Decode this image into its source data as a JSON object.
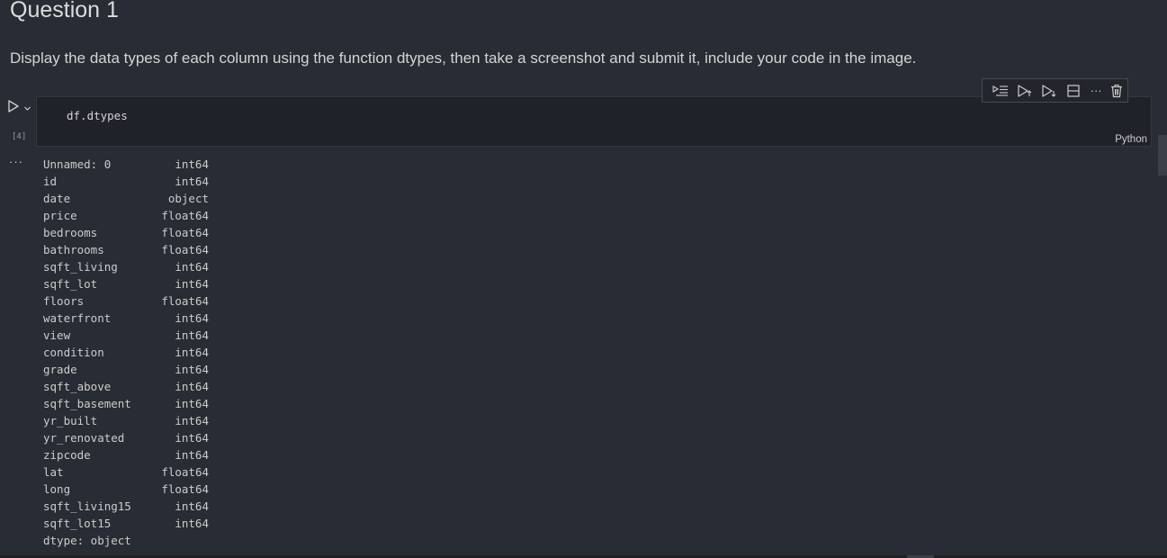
{
  "markdown": {
    "heading": "Question 1",
    "description": "Display the data types of each column using the function dtypes, then take a screenshot and submit it, include your code in the image."
  },
  "cell": {
    "execution_count": "[4]",
    "code": "df.dtypes",
    "language": "Python",
    "toolbar": {
      "icons": [
        "run-by-line-icon",
        "execute-above-icon",
        "execute-below-icon",
        "split-cell-icon",
        "more-actions-icon",
        "delete-icon"
      ],
      "more_label": "···"
    }
  },
  "output": {
    "more_label": "···",
    "rows": [
      {
        "name": "Unnamed: 0",
        "dtype": "int64"
      },
      {
        "name": "id",
        "dtype": "int64"
      },
      {
        "name": "date",
        "dtype": "object"
      },
      {
        "name": "price",
        "dtype": "float64"
      },
      {
        "name": "bedrooms",
        "dtype": "float64"
      },
      {
        "name": "bathrooms",
        "dtype": "float64"
      },
      {
        "name": "sqft_living",
        "dtype": "int64"
      },
      {
        "name": "sqft_lot",
        "dtype": "int64"
      },
      {
        "name": "floors",
        "dtype": "float64"
      },
      {
        "name": "waterfront",
        "dtype": "int64"
      },
      {
        "name": "view",
        "dtype": "int64"
      },
      {
        "name": "condition",
        "dtype": "int64"
      },
      {
        "name": "grade",
        "dtype": "int64"
      },
      {
        "name": "sqft_above",
        "dtype": "int64"
      },
      {
        "name": "sqft_basement",
        "dtype": "int64"
      },
      {
        "name": "yr_built",
        "dtype": "int64"
      },
      {
        "name": "yr_renovated",
        "dtype": "int64"
      },
      {
        "name": "zipcode",
        "dtype": "int64"
      },
      {
        "name": "lat",
        "dtype": "float64"
      },
      {
        "name": "long",
        "dtype": "float64"
      },
      {
        "name": "sqft_living15",
        "dtype": "int64"
      },
      {
        "name": "sqft_lot15",
        "dtype": "int64"
      }
    ],
    "footer": "dtype: object"
  },
  "colors": {
    "background": "#282c34",
    "cell_background": "#1f2228",
    "text": "#cccccc"
  }
}
